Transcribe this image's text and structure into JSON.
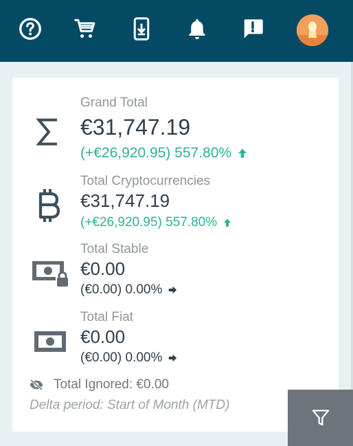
{
  "topbar": {
    "background": "#054a64",
    "icons": [
      "help-icon",
      "cart-icon",
      "mobile-download-icon",
      "bell-icon",
      "feedback-icon"
    ]
  },
  "avatar": {
    "color": "#f5a05a"
  },
  "summary": {
    "grand_total": {
      "label": "Grand Total",
      "value": "€31,747.19",
      "delta": "(+€26,920.95) 557.80%",
      "trend": "up",
      "icon": "sigma-icon"
    },
    "crypto": {
      "label": "Total Cryptocurrencies",
      "value": "€31,747.19",
      "delta": "(+€26,920.95) 557.80%",
      "trend": "up",
      "icon": "bitcoin-icon"
    },
    "stable": {
      "label": "Total Stable",
      "value": "€0.00",
      "delta": "(€0.00) 0.00%",
      "trend": "flat",
      "icon": "cash-lock-icon"
    },
    "fiat": {
      "label": "Total Fiat",
      "value": "€0.00",
      "delta": "(€0.00) 0.00%",
      "trend": "flat",
      "icon": "cash-icon"
    },
    "ignored": {
      "label": "Total Ignored: €0.00",
      "icon": "eye-off-icon"
    },
    "delta_period": "Delta period: Start of Month (MTD)"
  },
  "filter_button": {
    "icon": "filter-icon",
    "color": "#6d747b"
  },
  "colors": {
    "positive": "#2bb391",
    "text": "#2f3e4b",
    "muted": "#8f979c"
  }
}
